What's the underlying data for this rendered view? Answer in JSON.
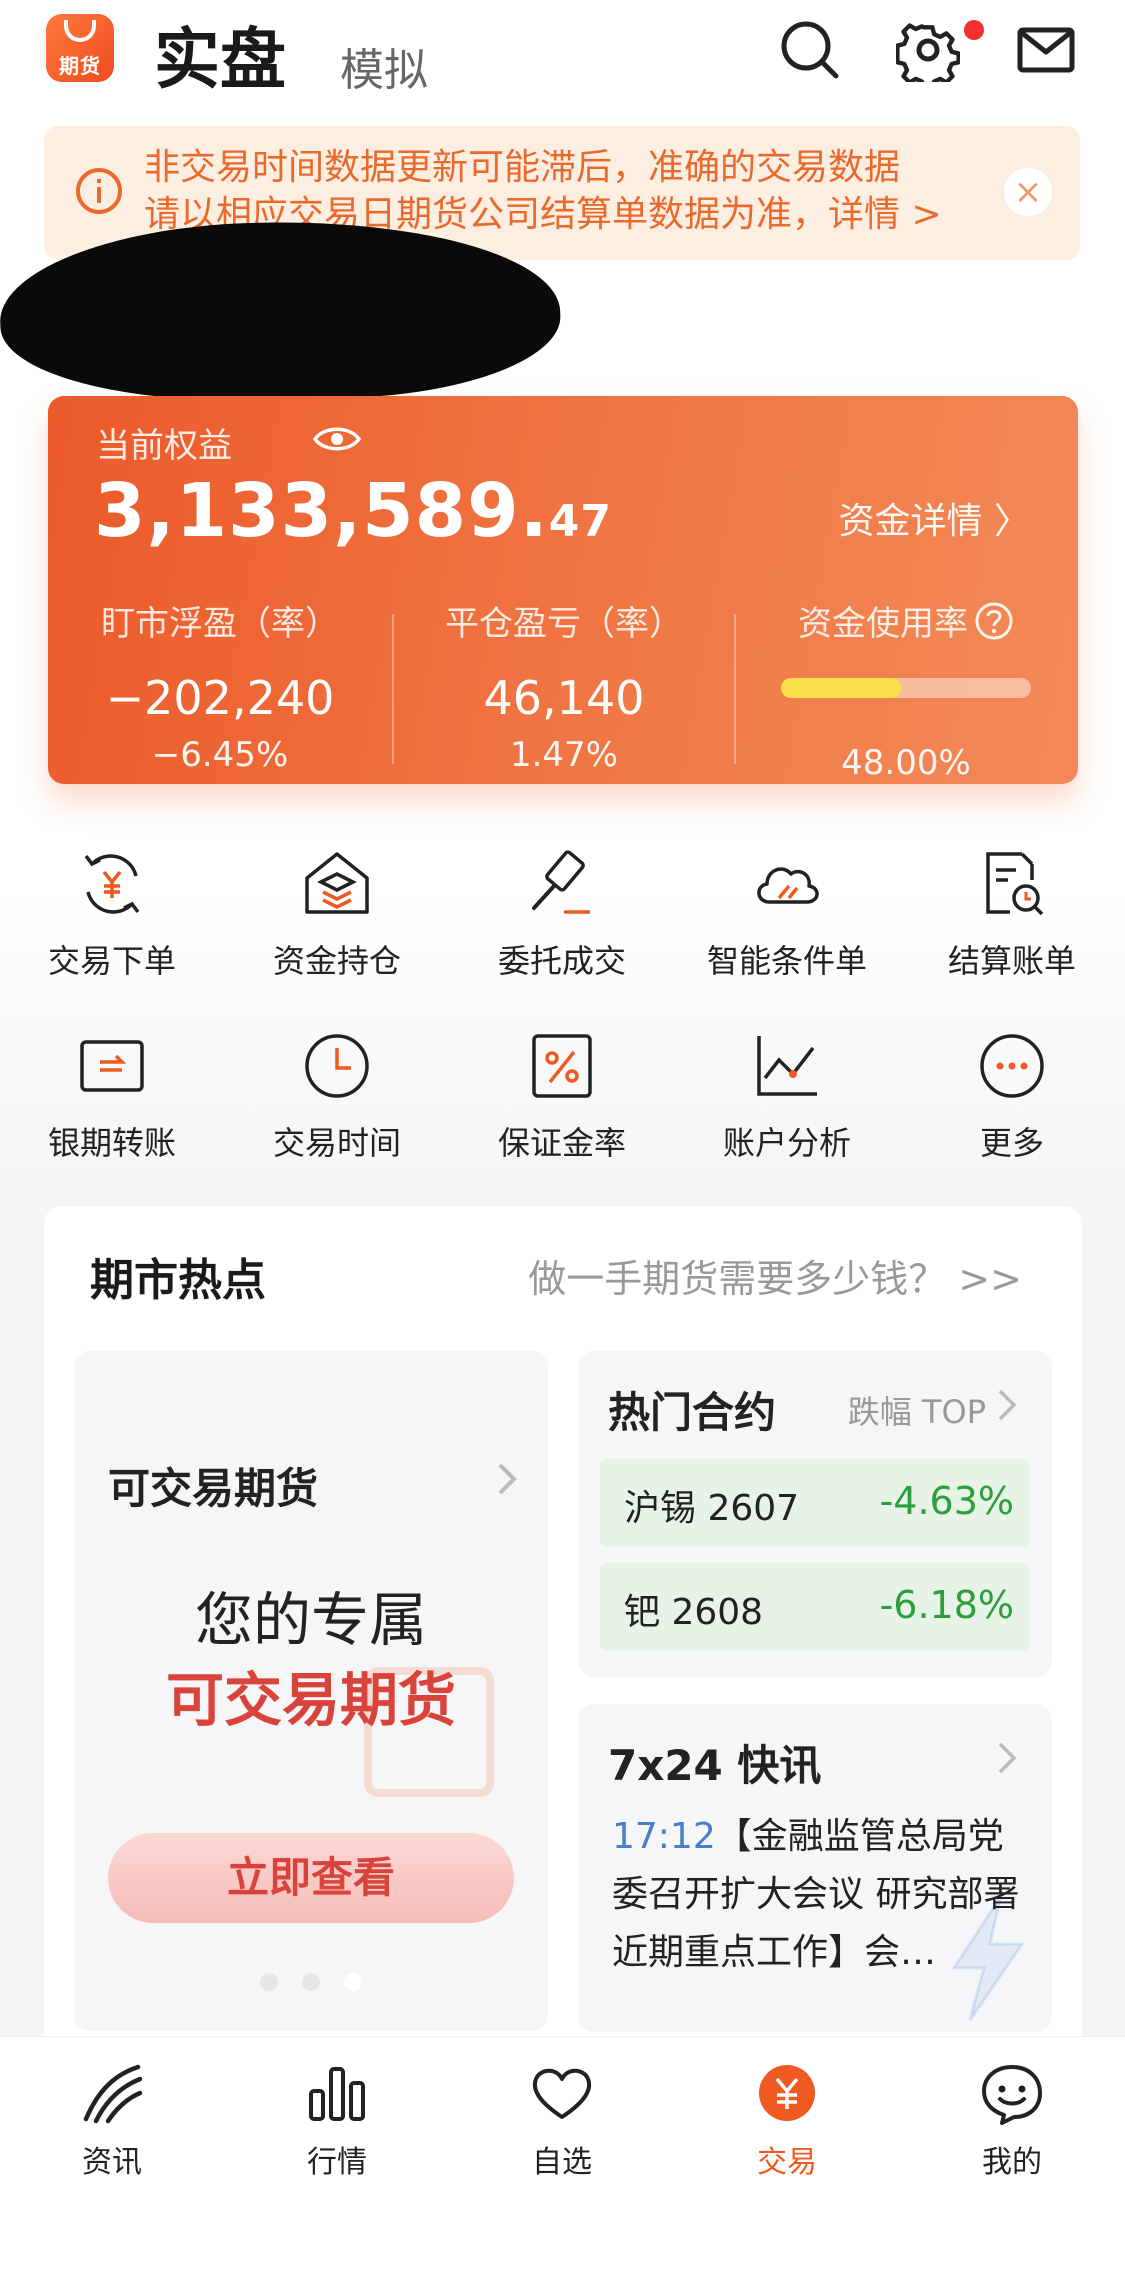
{
  "header": {
    "logo_text": "期货",
    "tab_real": "实盘",
    "tab_sim": "模拟",
    "icons": [
      "search-icon",
      "gear-icon",
      "mail-icon"
    ]
  },
  "notice": {
    "line1": "非交易时间数据更新可能滞后，准确的交易数据",
    "line2": "请以相应交易日期货公司结算单数据为准，详情 >",
    "close": "×"
  },
  "equity": {
    "label": "当前权益",
    "value_main": "3,133,589.",
    "value_cents": "47",
    "detail_link": "资金详情 〉",
    "stats": [
      {
        "label": "盯市浮盈（率）",
        "main": "−202,240",
        "sub": "−6.45%"
      },
      {
        "label": "平仓盈亏（率）",
        "main": "46,140",
        "sub": "1.47%"
      },
      {
        "label": "资金使用率",
        "main": "",
        "sub": "48.00%"
      }
    ],
    "usage_ratio": 0.48,
    "accent_color": "#ec5a2a"
  },
  "functions": [
    {
      "label": "交易下单",
      "icon": "yuan-cycle-icon"
    },
    {
      "label": "资金持仓",
      "icon": "house-layers-icon"
    },
    {
      "label": "委托成交",
      "icon": "gavel-icon"
    },
    {
      "label": "智能条件单",
      "icon": "cloud-icon"
    },
    {
      "label": "结算账单",
      "icon": "bill-search-icon"
    },
    {
      "label": "银期转账",
      "icon": "card-transfer-icon"
    },
    {
      "label": "交易时间",
      "icon": "clock-icon"
    },
    {
      "label": "保证金率",
      "icon": "percent-icon"
    },
    {
      "label": "账户分析",
      "icon": "line-chart-icon"
    },
    {
      "label": "更多",
      "icon": "more-icon"
    }
  ],
  "hot": {
    "title": "期市热点",
    "link": "做一手期货需要多少钱？ >>",
    "tradable": {
      "title": "可交易期货",
      "line1": "您的专属",
      "line2": "可交易期货",
      "button": "立即查看"
    },
    "contracts": {
      "title": "热门合约",
      "sub": "跌幅 TOP",
      "rows": [
        {
          "name": "沪锡 2607",
          "change": "-4.63%"
        },
        {
          "name": "钯 2608",
          "change": "-6.18%"
        }
      ],
      "down_color": "#2e9e3c"
    },
    "news": {
      "title": "7x24 快讯",
      "time": "17:12",
      "text": "【金融监管总局党委召开扩大会议 研究部署近期重点工作】会…"
    }
  },
  "nav": [
    {
      "label": "资讯",
      "icon": "news-icon"
    },
    {
      "label": "行情",
      "icon": "bars-icon"
    },
    {
      "label": "自选",
      "icon": "heart-icon"
    },
    {
      "label": "交易",
      "icon": "yuan-icon"
    },
    {
      "label": "我的",
      "icon": "face-icon"
    }
  ],
  "nav_active": "交易"
}
